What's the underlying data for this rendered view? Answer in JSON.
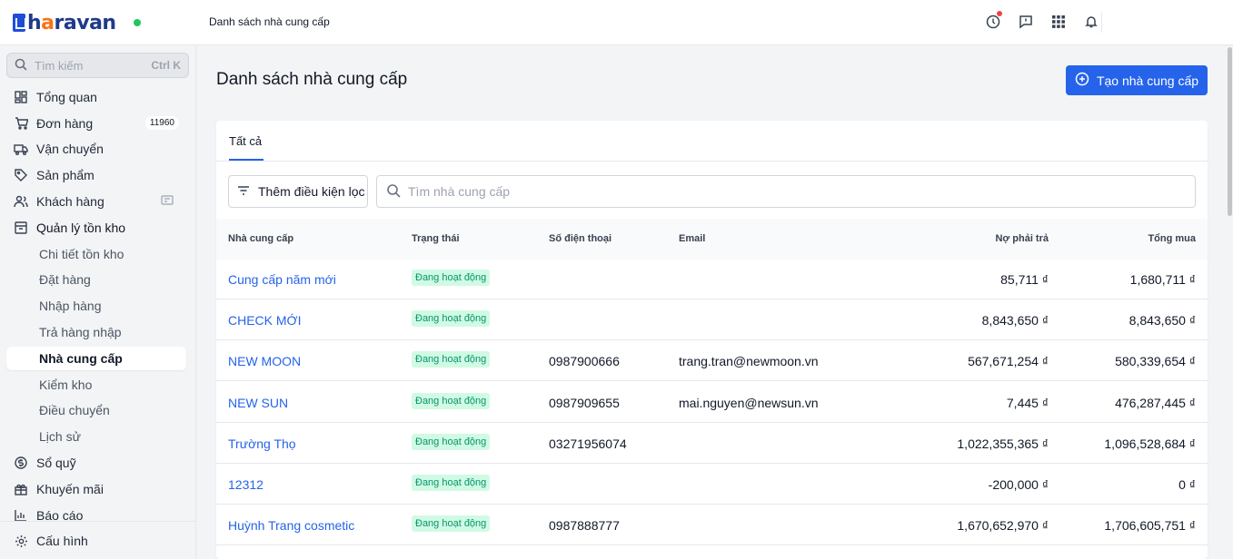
{
  "app": {
    "brand": "haravan",
    "page_title": "Danh sách nhà cung cấp"
  },
  "sidebar": {
    "search_placeholder": "Tìm kiếm",
    "search_shortcut": "Ctrl K",
    "items": [
      {
        "label": "Tổng quan",
        "icon": "dashboard-icon"
      },
      {
        "label": "Đơn hàng",
        "icon": "cart-icon",
        "badge": "11960"
      },
      {
        "label": "Vận chuyển",
        "icon": "truck-icon"
      },
      {
        "label": "Sản phẩm",
        "icon": "tag-icon"
      },
      {
        "label": "Khách hàng",
        "icon": "users-icon"
      },
      {
        "label": "Quản lý tồn kho",
        "icon": "inventory-icon"
      },
      {
        "label": "Chi tiết tồn kho"
      },
      {
        "label": "Đặt hàng"
      },
      {
        "label": "Nhập hàng"
      },
      {
        "label": "Trả hàng nhập"
      },
      {
        "label": "Nhà cung cấp"
      },
      {
        "label": "Kiểm kho"
      },
      {
        "label": "Điều chuyển"
      },
      {
        "label": "Lịch sử"
      },
      {
        "label": "Sổ quỹ",
        "icon": "dollar-icon"
      },
      {
        "label": "Khuyến mãi",
        "icon": "gift-icon"
      },
      {
        "label": "Báo cáo",
        "icon": "report-icon"
      }
    ],
    "settings_label": "Cấu hình"
  },
  "main": {
    "title": "Danh sách nhà cung cấp",
    "create_button": "Tạo nhà cung cấp",
    "tab_all": "Tất cả",
    "filter_button": "Thêm điều kiện lọc",
    "search_placeholder": "Tìm nhà cung cấp",
    "columns": {
      "name": "Nhà cung cấp",
      "status": "Trạng thái",
      "phone": "Số điện thoại",
      "email": "Email",
      "debt": "Nợ phải trả",
      "total": "Tổng mua"
    },
    "rows": [
      {
        "name": "Cung cấp năm mới",
        "status": "Đang hoạt động",
        "phone": "",
        "email": "",
        "debt": "85,711 ₫",
        "total": "1,680,711 ₫"
      },
      {
        "name": "CHECK MỚI",
        "status": "Đang hoạt động",
        "phone": "",
        "email": "",
        "debt": "8,843,650 ₫",
        "total": "8,843,650 ₫"
      },
      {
        "name": "NEW MOON",
        "status": "Đang hoạt động",
        "phone": "0987900666",
        "email": "trang.tran@newmoon.vn",
        "debt": "567,671,254 ₫",
        "total": "580,339,654 ₫"
      },
      {
        "name": "NEW SUN",
        "status": "Đang hoạt động",
        "phone": "0987909655",
        "email": "mai.nguyen@newsun.vn",
        "debt": "7,445 ₫",
        "total": "476,287,445 ₫"
      },
      {
        "name": "Trường Thọ",
        "status": "Đang hoạt động",
        "phone": "03271956074",
        "email": "",
        "debt": "1,022,355,365 ₫",
        "total": "1,096,528,684 ₫"
      },
      {
        "name": "12312",
        "status": "Đang hoạt động",
        "phone": "",
        "email": "",
        "debt": "-200,000 ₫",
        "total": "0 ₫"
      },
      {
        "name": "Huỳnh Trang cosmetic",
        "status": "Đang hoạt động",
        "phone": "0987888777",
        "email": "",
        "debt": "1,670,652,970 ₫",
        "total": "1,706,605,751 ₫"
      }
    ]
  },
  "colors": {
    "accent": "#2563eb",
    "status_bg": "#d1fae5",
    "status_text": "#059669",
    "online": "#22c55e"
  }
}
